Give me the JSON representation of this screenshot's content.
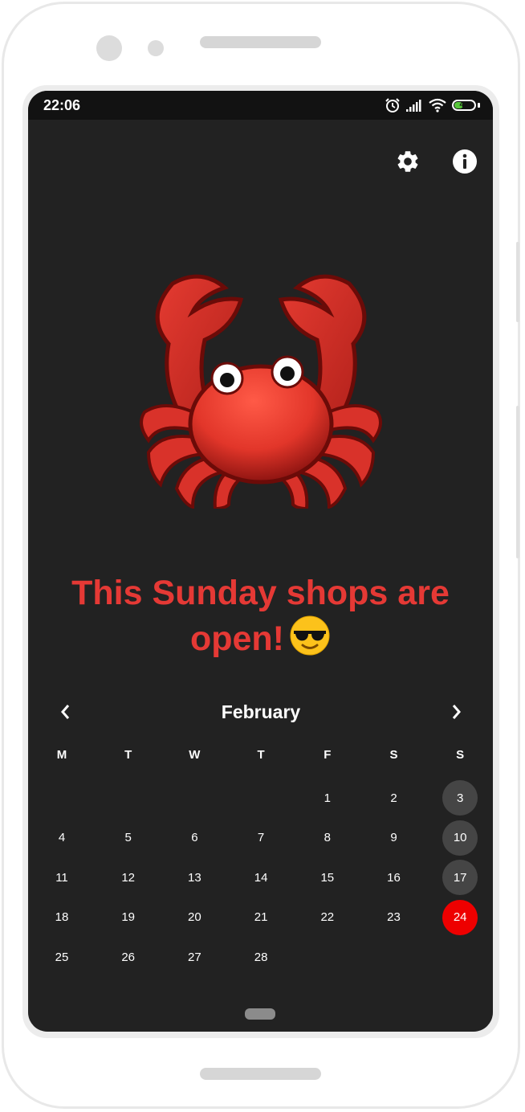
{
  "status_bar": {
    "time": "22:06",
    "battery_level": "47",
    "battery_fraction": 0.47,
    "icons": [
      "alarm-icon",
      "signal-icon",
      "wifi-icon",
      "battery-icon"
    ]
  },
  "toolbar": {
    "icons": [
      "settings-icon",
      "info-icon"
    ]
  },
  "headline": {
    "text": "This Sunday shops are open!",
    "emoji": "smiling-face-with-sunglasses"
  },
  "calendar": {
    "month": "February",
    "weekdays": [
      "M",
      "T",
      "W",
      "T",
      "F",
      "S",
      "S"
    ],
    "weeks": [
      [
        "",
        "",
        "",
        "",
        "1",
        "2",
        "3"
      ],
      [
        "4",
        "5",
        "6",
        "7",
        "8",
        "9",
        "10"
      ],
      [
        "11",
        "12",
        "13",
        "14",
        "15",
        "16",
        "17"
      ],
      [
        "18",
        "19",
        "20",
        "21",
        "22",
        "23",
        "24"
      ],
      [
        "25",
        "26",
        "27",
        "28",
        "",
        "",
        ""
      ]
    ],
    "highlighted_sundays": [
      "3",
      "10",
      "17"
    ],
    "open_sunday": "24"
  },
  "colors": {
    "background": "#222222",
    "accent_red": "#e53935",
    "today_red": "#ee0000",
    "sunday_circle": "#454545"
  }
}
